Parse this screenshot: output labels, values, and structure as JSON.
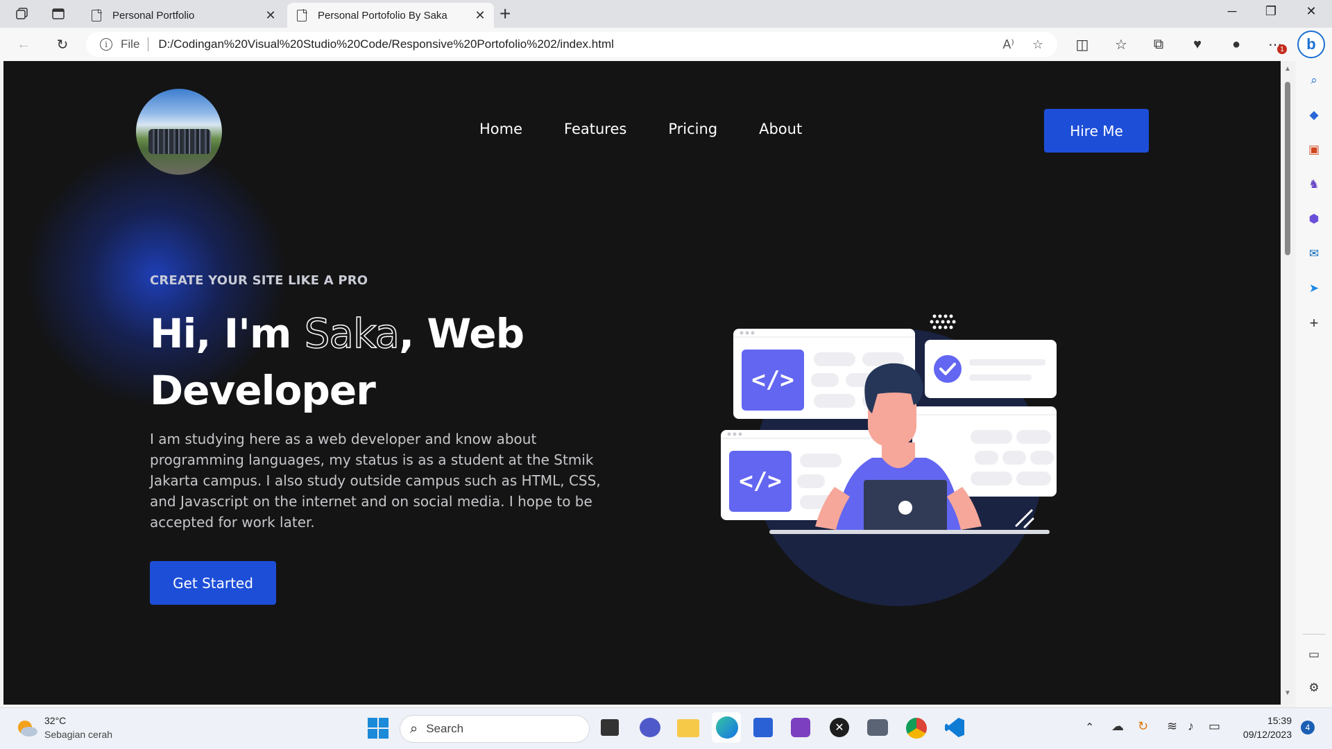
{
  "browser": {
    "tabs": [
      {
        "title": "Personal Portfolio",
        "active": false
      },
      {
        "title": "Personal Portofolio By Saka",
        "active": true
      }
    ],
    "address": {
      "scheme_label": "File",
      "url": "D:/Codingan%20Visual%20Studio%20Code/Responsive%20Portofolio%202/index.html"
    },
    "notification_badge": "1"
  },
  "page": {
    "nav": {
      "items": [
        "Home",
        "Features",
        "Pricing",
        "About"
      ],
      "cta": "Hire Me"
    },
    "hero": {
      "eyebrow": "CREATE YOUR SITE LIKE A PRO",
      "greeting": "Hi, I'm ",
      "name": "Saka",
      "role_part1": ", Web",
      "role_part2": "Developer",
      "description": "I am studying here as a web developer and know about programming languages, my status is as a student at the Stmik Jakarta campus. I also study outside campus such as HTML, CSS, and Javascript on the internet and on social media. I hope to be accepted for work later.",
      "cta": "Get Started"
    },
    "colors": {
      "background": "#141414",
      "accent": "#1d4ed8",
      "illustration_purple": "#6366f1"
    }
  },
  "taskbar": {
    "weather": {
      "temp": "32°C",
      "condition": "Sebagian cerah"
    },
    "search_placeholder": "Search",
    "clock": {
      "time": "15:39",
      "date": "09/12/2023"
    },
    "notification_count": "4"
  }
}
